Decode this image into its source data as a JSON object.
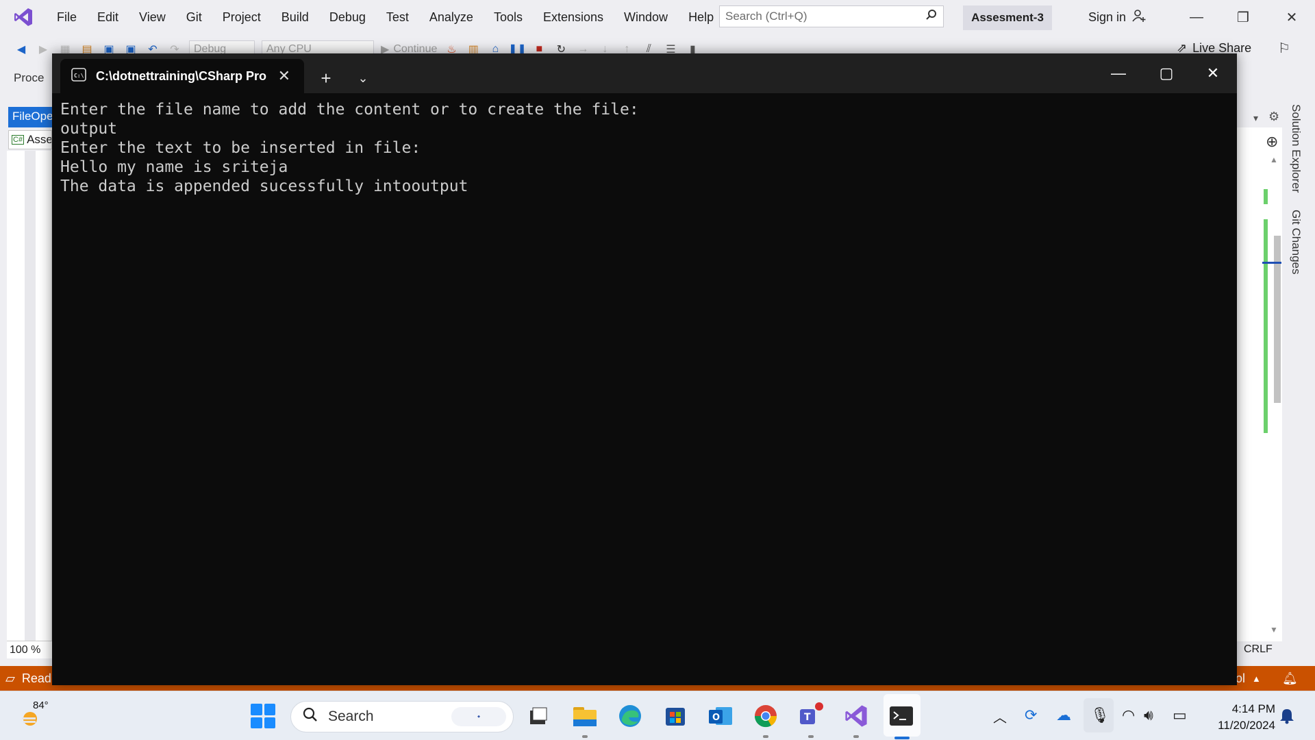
{
  "vs": {
    "menu": [
      "File",
      "Edit",
      "View",
      "Git",
      "Project",
      "Build",
      "Debug",
      "Test",
      "Analyze",
      "Tools",
      "Extensions",
      "Window",
      "Help"
    ],
    "search_placeholder": "Search (Ctrl+Q)",
    "solution_name": "Assesment-3",
    "sign_in": "Sign in",
    "toolbar": {
      "config": "Debug",
      "platform": "Any CPU",
      "continue": "Continue",
      "live_share": "Live Share"
    },
    "process_label": "Proce",
    "doc_tab": "FileOpe",
    "doc_nav": "Asse",
    "zoom": "100 %",
    "line_ending": "CRLF",
    "side_tabs": [
      "Solution Explorer",
      "Git Changes"
    ],
    "status": {
      "left": "Read",
      "right": "ol"
    },
    "accent_color": "#1c6fd6",
    "status_color": "#ca5100"
  },
  "terminal": {
    "tab_title": "C:\\dotnettraining\\CSharp Pro",
    "lines": [
      "Enter the file name to add the content or to create the file:",
      "output",
      "Enter the text to be inserted in file:",
      "Hello my name is sriteja",
      "The data is appended sucessfully intooutput"
    ],
    "background": "#0c0c0c",
    "foreground": "#cccccc"
  },
  "taskbar": {
    "temperature": "84°",
    "search_label": "Search",
    "apps": [
      "task-view-icon",
      "file-explorer-icon",
      "edge-icon",
      "store-icon",
      "outlook-icon",
      "chrome-icon",
      "teams-icon",
      "visual-studio-icon",
      "terminal-icon"
    ],
    "time": "4:14 PM",
    "date": "11/20/2024"
  }
}
